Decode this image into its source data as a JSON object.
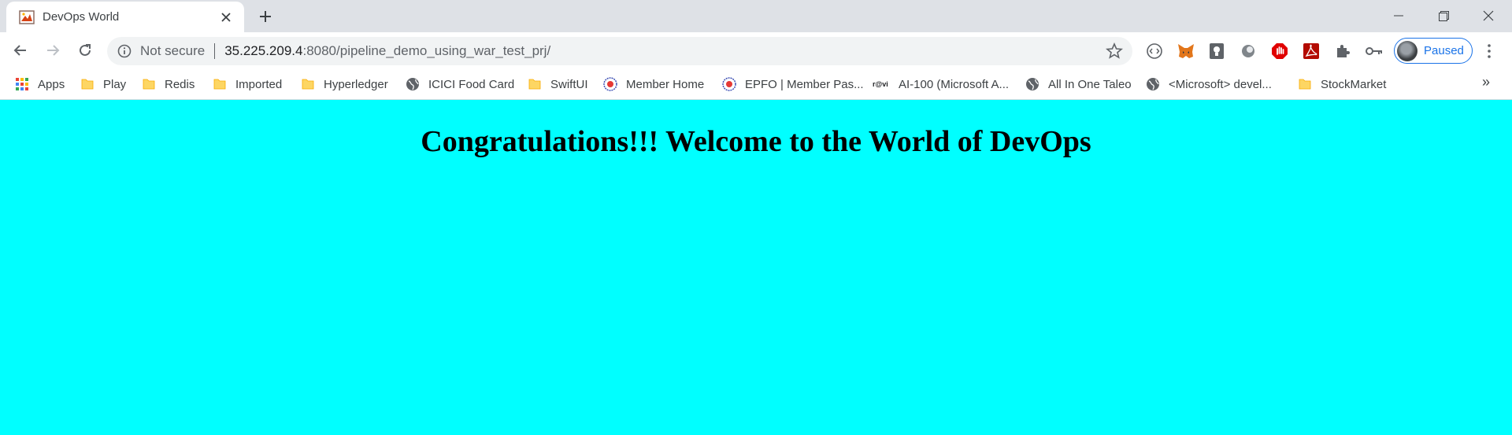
{
  "browser": {
    "tab": {
      "title": "DevOps World"
    },
    "window_controls": [
      "minimize",
      "restore",
      "close"
    ],
    "address_bar": {
      "security_label": "Not secure",
      "host": "35.225.209.4",
      "path": ":8080/pipeline_demo_using_war_test_prj/"
    },
    "profile": {
      "status": "Paused"
    },
    "bookmarks": [
      {
        "label": "Apps",
        "icon": "apps-grid-icon"
      },
      {
        "label": "Play",
        "icon": "folder-icon"
      },
      {
        "label": "Redis",
        "icon": "folder-icon"
      },
      {
        "label": "Imported",
        "icon": "folder-icon"
      },
      {
        "label": "Hyperledger",
        "icon": "folder-icon"
      },
      {
        "label": "ICICI Food Card",
        "icon": "globe-icon"
      },
      {
        "label": "SwiftUI",
        "icon": "folder-icon"
      },
      {
        "label": "Member Home",
        "icon": "epfo-logo-icon"
      },
      {
        "label": "EPFO | Member Pas...",
        "icon": "epfo-logo-icon"
      },
      {
        "label": "AI-100 (Microsoft A...",
        "icon": "revi-logo-icon"
      },
      {
        "label": "All In One Taleo",
        "icon": "globe-icon"
      },
      {
        "label": "<Microsoft> devel...",
        "icon": "globe-icon"
      },
      {
        "label": "StockMarket",
        "icon": "folder-icon"
      }
    ],
    "colors": {
      "tabstrip": "#dee1e6",
      "accent": "#1a73e8",
      "page_background": "#00ffff"
    }
  },
  "page": {
    "heading": "Congratulations!!! Welcome to the World of DevOps"
  }
}
